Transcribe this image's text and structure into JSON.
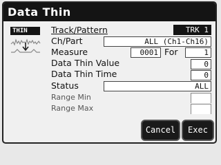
{
  "window": {
    "title": "Data Thin"
  },
  "mode_tag": "THIN",
  "fields": {
    "track_pattern": {
      "label": "Track/Pattern",
      "value": "TRK 1"
    },
    "ch_part": {
      "label": "Ch/Part",
      "value": "ALL (Ch1-Ch16)"
    },
    "measure": {
      "label": "Measure",
      "value": "0001",
      "for_label": "For",
      "for_value": "1"
    },
    "data_thin_value": {
      "label": "Data Thin Value",
      "value": "0"
    },
    "data_thin_time": {
      "label": "Data Thin Time",
      "value": "0"
    },
    "status": {
      "label": "Status",
      "value": "ALL"
    },
    "range_min": {
      "label": "Range Min",
      "value": ""
    },
    "range_max": {
      "label": "Range Max",
      "value": ""
    }
  },
  "buttons": {
    "cancel": "Cancel",
    "exec": "Exec"
  }
}
